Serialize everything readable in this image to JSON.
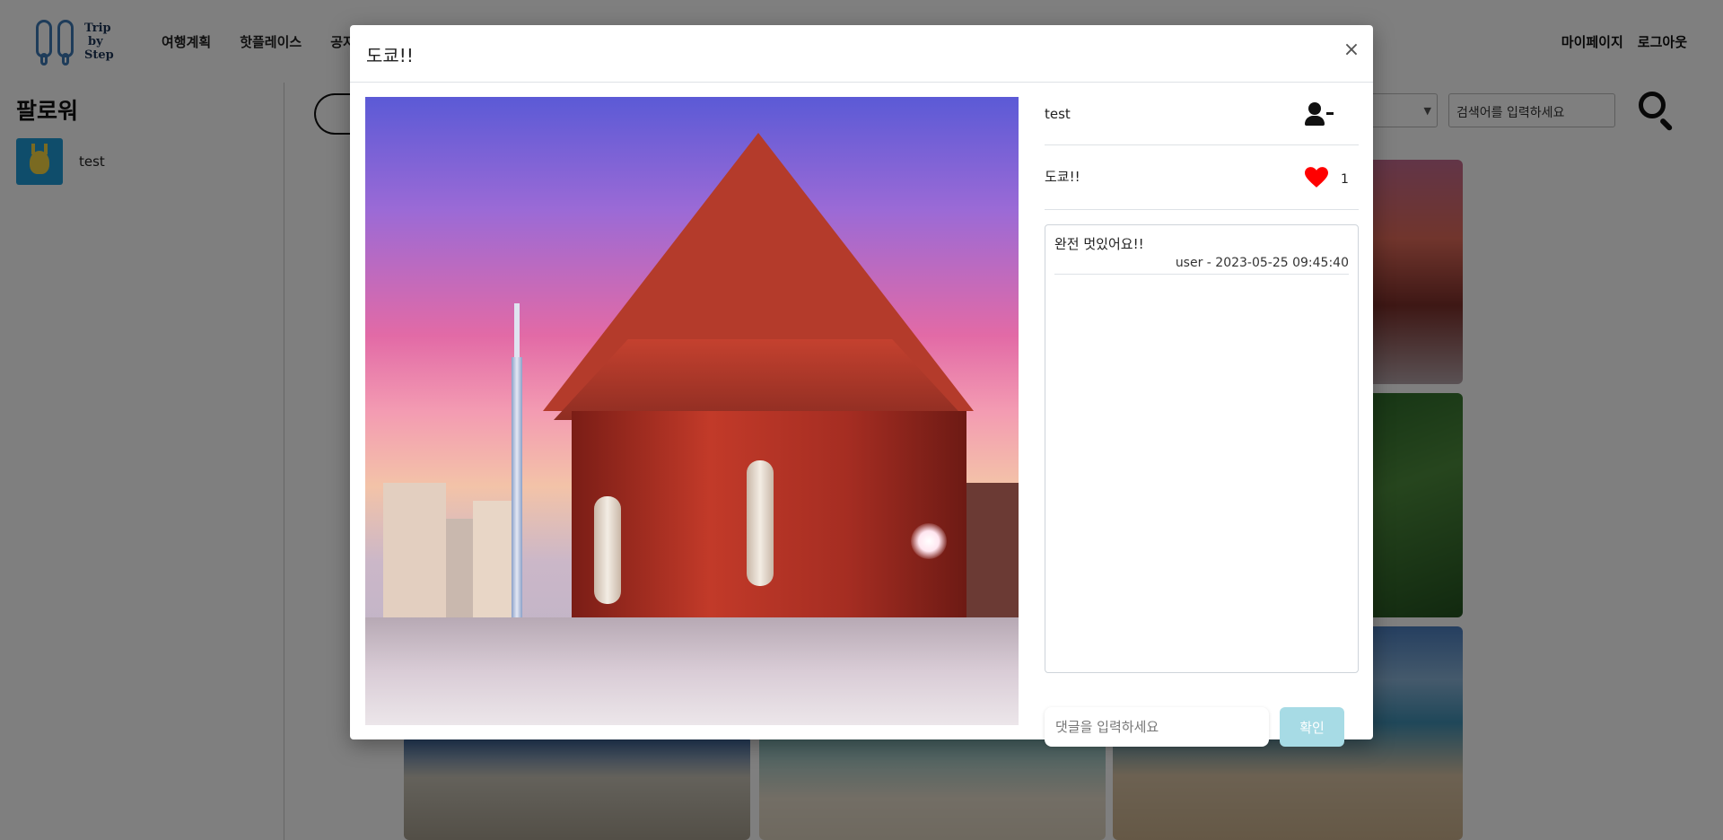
{
  "header": {
    "logo_lines": [
      "Trip",
      "by",
      "Step"
    ],
    "nav": [
      "여행계획",
      "핫플레이스",
      "공지사항"
    ],
    "nav_right": [
      "마이페이지",
      "로그아웃"
    ]
  },
  "sidebar": {
    "title": "팔로워",
    "followers": [
      {
        "name": "test"
      }
    ]
  },
  "search": {
    "placeholder": "검색어를 입력하세요"
  },
  "modal": {
    "title": "도쿄!!",
    "close_label": "×",
    "author": "test",
    "post_title": "도쿄!!",
    "like_count": "1",
    "comments": [
      {
        "text": "완전 멋있어요!!",
        "meta": "user - 2023-05-25 09:45:40"
      }
    ],
    "comment_placeholder": "댓글을 입력하세요",
    "submit_label": "확인"
  },
  "colors": {
    "like": "#ff0000",
    "submit_button": "#a7dbe5",
    "logo": "#3c78b4"
  }
}
